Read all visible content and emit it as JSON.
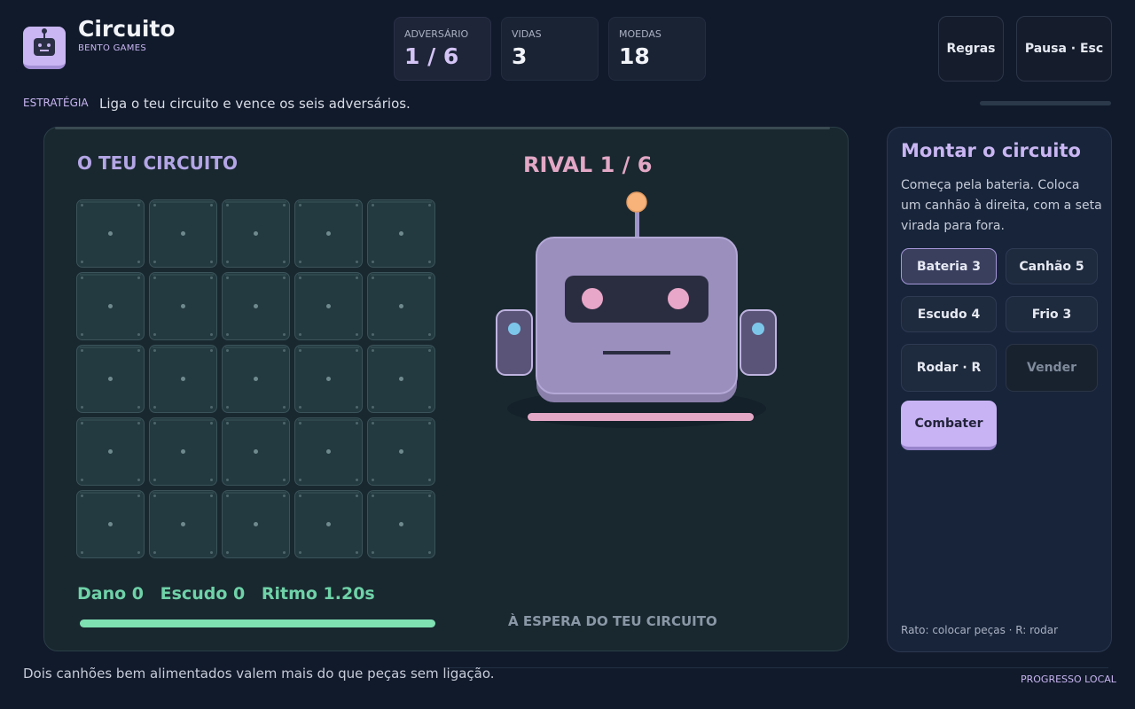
{
  "header": {
    "title": "Circuito",
    "subtitle": "BENTO GAMES",
    "stats": [
      {
        "label": "ADVERSÁRIO",
        "value": "1 / 6"
      },
      {
        "label": "VIDAS",
        "value": "3"
      },
      {
        "label": "MOEDAS",
        "value": "18"
      }
    ],
    "rules_label": "Regras",
    "pause_label": "Pausa · Esc"
  },
  "strategy": {
    "label": "ESTRATÉGIA",
    "text": "Liga o teu circuito e vence os seis adversários."
  },
  "arena": {
    "my_title": "O TEU CIRCUITO",
    "rival_title": "RIVAL 1 / 6",
    "grid": {
      "rows": 5,
      "cols": 5,
      "filled": 0
    },
    "stats": {
      "damage": "Dano 0",
      "shield": "Escudo 0",
      "rhythm": "Ritmo 1.20s"
    },
    "health_fraction": 1.0,
    "waiting_text": "À ESPERA DO TEU CIRCUITO"
  },
  "panel": {
    "title": "Montar o circuito",
    "description": "Começa pela bateria. Coloca um canhão à direita, com a seta virada para fora.",
    "buttons": [
      {
        "label": "Bateria  3",
        "selected": true
      },
      {
        "label": "Canhão  5"
      },
      {
        "label": "Escudo  4"
      },
      {
        "label": "Frio  3"
      },
      {
        "label": "Rodar · R"
      },
      {
        "label": "Vender",
        "disabled": true
      },
      {
        "label": "Combater"
      }
    ],
    "hint": "Rato: colocar peças  ·  R: rodar"
  },
  "footer": {
    "tip": "Dois canhões bem alimentados valem mais do que peças sem ligação.",
    "progress": "PROGRESSO LOCAL"
  },
  "colors": {
    "background": "#111a2b",
    "accent": "#c9b6f2",
    "rival": "#e3a8c6",
    "health": "#7fe0b2",
    "arena": "#19282f"
  },
  "icons": {
    "logo": "robot-icon",
    "rival": "robot-rival"
  }
}
